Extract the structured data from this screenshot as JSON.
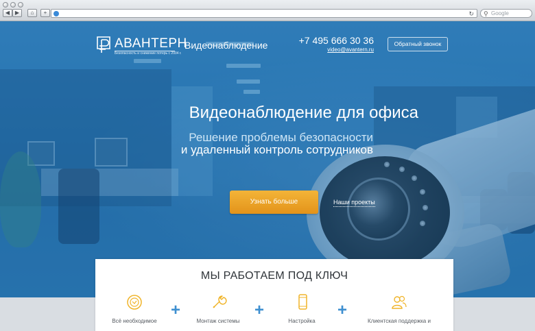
{
  "browser": {
    "search_placeholder": "Google",
    "back_glyph": "◀",
    "forward_glyph": "▶",
    "home_glyph": "⌂",
    "new_tab_glyph": "+",
    "refresh_glyph": "↻",
    "search_glyph": "⚲"
  },
  "header": {
    "logo_name": "АВАНТЕРН",
    "logo_tagline": "Безопасность и снижение потерь с 2004 г.",
    "title": "Видеонаблюдение",
    "phone": "+7 495 666 30 36",
    "email": "video@avantern.ru",
    "callback_label": "Обратный звонок"
  },
  "hero": {
    "title": "Видеонаблюдение для офиса",
    "subtitle_line1": "Решение проблемы безопасности",
    "subtitle_line2": "и удаленный контроль сотрудников",
    "cta_label": "Узнать больше",
    "projects_link": "Наши проекты"
  },
  "features": {
    "title": "МЫ РАБОТАЕМ ПОД КЛЮЧ",
    "items": [
      {
        "label": "Всё необходимое",
        "icon": "badge-icon"
      },
      {
        "label": "Монтаж системы",
        "icon": "wrench-icon"
      },
      {
        "label": "Настройка",
        "icon": "smartphone-icon"
      },
      {
        "label": "Клиентская поддержка и",
        "icon": "users-icon"
      }
    ],
    "separator": "+"
  },
  "colors": {
    "hero_blue": "#2f79b2",
    "accent_orange": "#e8a027",
    "icon_yellow": "#f0b429",
    "plus_blue": "#3e8fd0"
  }
}
